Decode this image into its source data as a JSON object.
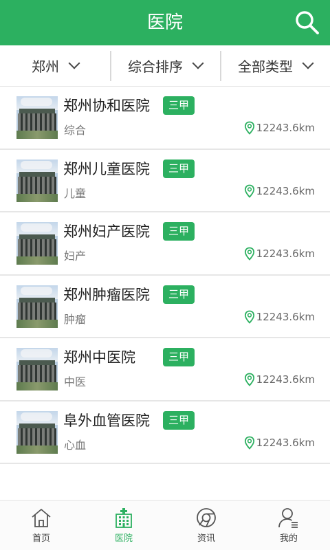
{
  "header": {
    "title": "医院"
  },
  "filters": [
    {
      "label": "郑州"
    },
    {
      "label": "综合排序"
    },
    {
      "label": "全部类型"
    }
  ],
  "hospitals": [
    {
      "name": "郑州协和医院",
      "level": "三甲",
      "category": "综合",
      "distance": "12243.6km"
    },
    {
      "name": "郑州儿童医院",
      "level": "三甲",
      "category": "儿童",
      "distance": "12243.6km"
    },
    {
      "name": "郑州妇产医院",
      "level": "三甲",
      "category": "妇产",
      "distance": "12243.6km"
    },
    {
      "name": "郑州肿瘤医院",
      "level": "三甲",
      "category": "肿瘤",
      "distance": "12243.6km"
    },
    {
      "name": "郑州中医院",
      "level": "三甲",
      "category": "中医",
      "distance": "12243.6km"
    },
    {
      "name": "阜外血管医院",
      "level": "三甲",
      "category": "心血",
      "distance": "12243.6km"
    }
  ],
  "tabs": [
    {
      "label": "首页",
      "icon": "home-icon"
    },
    {
      "label": "医院",
      "icon": "hospital-icon",
      "active": true
    },
    {
      "label": "资讯",
      "icon": "news-icon"
    },
    {
      "label": "我的",
      "icon": "profile-icon"
    }
  ],
  "colors": {
    "brand": "#2cb060",
    "divider": "#e6e6e6"
  }
}
